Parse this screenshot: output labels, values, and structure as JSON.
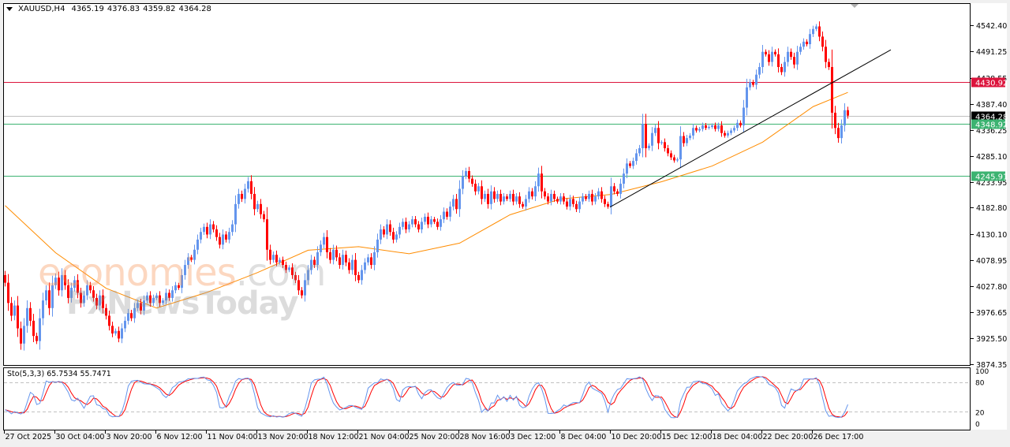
{
  "header": {
    "symbol": "XAUUSD,H4",
    "open": "4365.19",
    "high": "4376.83",
    "low": "4359.82",
    "close": "4364.28",
    "menu_icon": "triangle-down-icon"
  },
  "stochastic": {
    "label": "Sto(5,3,3)",
    "main": "65.7534",
    "signal": "55.7471",
    "levels": [
      "100",
      "80",
      "20",
      "0"
    ],
    "main_color": "#6495ED",
    "signal_color": "#FF0000"
  },
  "watermark": {
    "brand1": "economies",
    "brand1_suffix": ".com",
    "brand2": "FxNewsToday"
  },
  "colors": {
    "up": "#6495ED",
    "down": "#FF0000",
    "ma": "#FF8C00",
    "resistance": "#DC143C",
    "support": "#3CB371",
    "current": "#000000",
    "trendline": "#000000"
  },
  "chart_data": {
    "type": "candlestick",
    "title": "XAUUSD,H4",
    "ylim": [
      3874.35,
      4542.4
    ],
    "y_ticks": [
      "4542.40",
      "4491.25",
      "4438.55",
      "4387.40",
      "4336.25",
      "4285.10",
      "4233.95",
      "4182.80",
      "4130.10",
      "4078.95",
      "4027.80",
      "3976.65",
      "3925.50",
      "3874.35"
    ],
    "x_labels": [
      "27 Oct 2025",
      "30 Oct 04:00",
      "3 Nov 20:00",
      "6 Nov 12:00",
      "11 Nov 04:00",
      "13 Nov 20:00",
      "18 Nov 12:00",
      "21 Nov 04:00",
      "25 Nov 20:00",
      "28 Nov 16:00",
      "3 Dec 12:00",
      "8 Dec 04:00",
      "10 Dec 20:00",
      "15 Dec 12:00",
      "18 Dec 04:00",
      "22 Dec 20:00",
      "26 Dec 17:00"
    ],
    "first_open": 4050,
    "closes": [
      4035,
      3995,
      3970,
      3990,
      3945,
      3915,
      3950,
      3985,
      3960,
      3930,
      3920,
      3965,
      4000,
      4020,
      3985,
      4030,
      4045,
      4020,
      4050,
      4030,
      4005,
      4025,
      4040,
      4015,
      3995,
      4010,
      4030,
      4020,
      4005,
      3990,
      4010,
      3985,
      3970,
      3950,
      3935,
      3940,
      3925,
      3945,
      3960,
      3975,
      3965,
      3985,
      3995,
      3980,
      4000,
      4010,
      3995,
      4005,
      4010,
      3995,
      4000,
      4015,
      4005,
      4020,
      4030,
      4025,
      4050,
      4070,
      4085,
      4080,
      4100,
      4120,
      4135,
      4145,
      4130,
      4150,
      4140,
      4125,
      4110,
      4130,
      4120,
      4135,
      4150,
      4190,
      4210,
      4200,
      4220,
      4235,
      4210,
      4180,
      4190,
      4170,
      4160,
      4100,
      4080,
      4090,
      4075,
      4080,
      4070,
      4060,
      4065,
      4050,
      4040,
      4020,
      4010,
      4040,
      4060,
      4080,
      4070,
      4095,
      4110,
      4125,
      4095,
      4080,
      4100,
      4085,
      4070,
      4090,
      4075,
      4060,
      4080,
      4050,
      4040,
      4060,
      4075,
      4085,
      4070,
      4095,
      4120,
      4140,
      4130,
      4150,
      4135,
      4120,
      4130,
      4145,
      4155,
      4140,
      4150,
      4160,
      4150,
      4140,
      4155,
      4165,
      4150,
      4160,
      4155,
      4145,
      4160,
      4175,
      4165,
      4185,
      4200,
      4180,
      4220,
      4245,
      4255,
      4240,
      4230,
      4215,
      4225,
      4200,
      4210,
      4190,
      4215,
      4200,
      4210,
      4195,
      4205,
      4200,
      4210,
      4195,
      4205,
      4190,
      4185,
      4200,
      4215,
      4205,
      4225,
      4250,
      4215,
      4205,
      4195,
      4210,
      4200,
      4195,
      4205,
      4195,
      4185,
      4200,
      4190,
      4180,
      4195,
      4205,
      4200,
      4210,
      4195,
      4205,
      4215,
      4200,
      4190,
      4185,
      4225,
      4215,
      4210,
      4230,
      4250,
      4270,
      4265,
      4275,
      4290,
      4300,
      4348,
      4300,
      4305,
      4330,
      4340,
      4310,
      4312,
      4300,
      4290,
      4282,
      4276,
      4278,
      4324,
      4310,
      4320,
      4325,
      4340,
      4335,
      4338,
      4345,
      4340,
      4342,
      4345,
      4338,
      4345,
      4330,
      4325,
      4330,
      4335,
      4340,
      4350,
      4345,
      4380,
      4420,
      4430,
      4425,
      4445,
      4460,
      4490,
      4485,
      4470,
      4490,
      4485,
      4460,
      4450,
      4470,
      4490,
      4480,
      4465,
      4490,
      4500,
      4510,
      4505,
      4525,
      4535,
      4540,
      4520,
      4500,
      4470,
      4460,
      4370,
      4340,
      4320,
      4345,
      4375,
      4364.28
    ],
    "moving_average_at_labels": [
      4187,
      4094,
      4024,
      3985,
      4016,
      4055,
      4099,
      4106,
      4092,
      4113,
      4169,
      4200,
      4209,
      4234,
      4265,
      4312,
      4382
    ],
    "moving_average_last": 4410,
    "horizontal_lines": [
      {
        "price": "4430.92",
        "kind": "resistance"
      },
      {
        "price": "4364.28",
        "kind": "current"
      },
      {
        "price": "4348.92",
        "kind": "support"
      },
      {
        "price": "4245.91",
        "kind": "support"
      }
    ],
    "trendline": {
      "start_time": "10 Dec 20:00",
      "start_price": 4184,
      "end_price": 4494
    }
  }
}
